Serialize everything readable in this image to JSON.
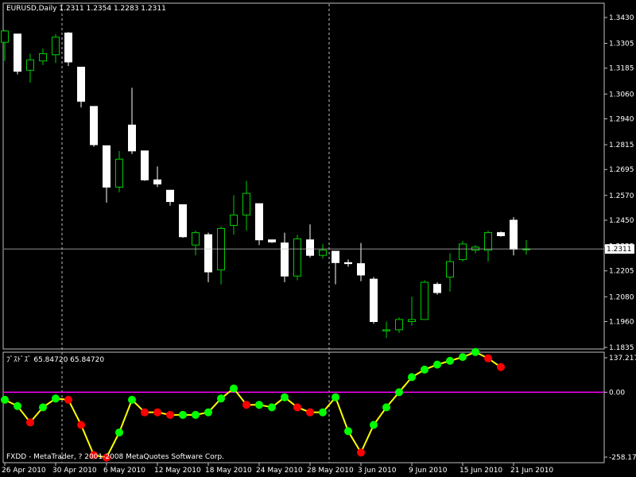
{
  "header": {
    "symbol_info": "EURUSD,Daily  1.2311 1.2354 1.2283 1.2311",
    "indicator_info": "ﾌﾞｽﾄﾞｽﾞ 65.84720 65.84720",
    "footer": "FXDD - MetaTrader, ? 2001-2008 MetaQuotes Software Corp."
  },
  "colors": {
    "background": "#000000",
    "bull_candle_fill": "#000000",
    "bull_candle_line": "#00cc00",
    "bear_candle_fill": "#ffffff",
    "bear_candle_line": "#ffffff",
    "indicator_line": "#ffff00",
    "up_dot": "#00ff00",
    "down_dot": "#ff0000",
    "zero_line": "#ff00ff",
    "grid": "#c0c0c0",
    "text": "#ffffff"
  },
  "chart_data": [
    {
      "type": "candlestick",
      "title": "EURUSD,Daily",
      "ylim": [
        1.1835,
        1.343
      ],
      "y_ticks": [
        "1.3430",
        "1.3305",
        "1.3185",
        "1.3060",
        "1.2940",
        "1.2815",
        "1.2695",
        "1.2570",
        "1.2450",
        "1.2325",
        "1.2205",
        "1.2080",
        "1.1960",
        "1.1835"
      ],
      "current_price_label": "1.2311",
      "current_price": 1.2311,
      "x_ticks": [
        "26 Apr 2010",
        "30 Apr 2010",
        "6 May 2010",
        "12 May 2010",
        "18 May 2010",
        "24 May 2010",
        "28 May 2010",
        "3 Jun 2010",
        "9 Jun 2010",
        "15 Jun 2010",
        "21 Jun 2010"
      ],
      "x_tick_index": [
        0,
        4,
        8,
        12,
        16,
        20,
        24,
        28,
        32,
        36,
        40
      ],
      "period_separator_index": [
        4.5,
        25.5
      ],
      "ohlc": [
        [
          1.331,
          1.337,
          1.322,
          1.3365
        ],
        [
          1.335,
          1.335,
          1.3155,
          1.317
        ],
        [
          1.3175,
          1.3255,
          1.3115,
          1.3225
        ],
        [
          1.322,
          1.328,
          1.32,
          1.3255
        ],
        [
          1.325,
          1.335,
          1.321,
          1.3335
        ],
        [
          1.3355,
          1.336,
          1.3195,
          1.3215
        ],
        [
          1.319,
          1.319,
          1.2995,
          1.3025
        ],
        [
          1.3,
          1.3,
          1.2805,
          1.2815
        ],
        [
          1.281,
          1.281,
          1.2535,
          1.261
        ],
        [
          1.261,
          1.2785,
          1.2585,
          1.2745
        ],
        [
          1.291,
          1.309,
          1.277,
          1.2785
        ],
        [
          1.2785,
          1.2785,
          1.264,
          1.2645
        ],
        [
          1.2645,
          1.271,
          1.261,
          1.2625
        ],
        [
          1.2595,
          1.2595,
          1.252,
          1.254
        ],
        [
          1.2525,
          1.2525,
          1.2365,
          1.237
        ],
        [
          1.233,
          1.24,
          1.228,
          1.239
        ],
        [
          1.238,
          1.239,
          1.215,
          1.22
        ],
        [
          1.221,
          1.242,
          1.214,
          1.241
        ],
        [
          1.2425,
          1.257,
          1.238,
          1.2475
        ],
        [
          1.2475,
          1.264,
          1.24,
          1.258
        ],
        [
          1.253,
          1.253,
          1.233,
          1.2355
        ],
        [
          1.2355,
          1.2355,
          1.234,
          1.2345
        ],
        [
          1.234,
          1.239,
          1.215,
          1.218
        ],
        [
          1.218,
          1.238,
          1.216,
          1.236
        ],
        [
          1.2355,
          1.243,
          1.227,
          1.228
        ],
        [
          1.228,
          1.2335,
          1.2265,
          1.2305
        ],
        [
          1.23,
          1.23,
          1.214,
          1.2245
        ],
        [
          1.2245,
          1.226,
          1.2225,
          1.224
        ],
        [
          1.224,
          1.234,
          1.2155,
          1.2185
        ],
        [
          1.2165,
          1.2175,
          1.195,
          1.196
        ],
        [
          1.1915,
          1.196,
          1.188,
          1.192
        ],
        [
          1.192,
          1.198,
          1.1905,
          1.197
        ],
        [
          1.196,
          1.208,
          1.194,
          1.197
        ],
        [
          1.197,
          1.216,
          1.197,
          1.215
        ],
        [
          1.214,
          1.215,
          1.209,
          1.21
        ],
        [
          1.2175,
          1.229,
          1.2105,
          1.225
        ],
        [
          1.226,
          1.235,
          1.225,
          1.2335
        ],
        [
          1.2305,
          1.233,
          1.229,
          1.232
        ],
        [
          1.2305,
          1.24,
          1.225,
          1.239
        ],
        [
          1.239,
          1.2395,
          1.237,
          1.2375
        ],
        [
          1.245,
          1.2465,
          1.228,
          1.231
        ],
        [
          1.2311,
          1.2354,
          1.2283,
          1.2311
        ]
      ]
    },
    {
      "type": "line",
      "title": "ﾌﾞｽﾄﾞｽﾞ",
      "ylim": [
        -258.171,
        137.2173
      ],
      "y_ticks": [
        "137.2173",
        "0.00",
        "-258.171"
      ],
      "zero_line": 0,
      "series": [
        {
          "values": [
            -30,
            -55,
            -120,
            -60,
            -25,
            -30,
            -130,
            -250,
            -260,
            -160,
            -30,
            -80,
            -80,
            -90,
            -90,
            -90,
            -80,
            -25,
            15,
            -50,
            -50,
            -60,
            -20,
            -60,
            -80,
            -80,
            -20,
            -155,
            -240,
            -130,
            -60,
            0,
            60,
            90,
            110,
            125,
            140,
            160,
            135,
            100
          ],
          "dot_colors": [
            "green",
            "green",
            "red",
            "green",
            "green",
            "red",
            "red",
            "red",
            "red",
            "green",
            "green",
            "red",
            "red",
            "red",
            "green",
            "green",
            "green",
            "green",
            "green",
            "red",
            "green",
            "green",
            "green",
            "red",
            "red",
            "green",
            "green",
            "green",
            "red",
            "green",
            "green",
            "green",
            "green",
            "green",
            "green",
            "green",
            "green",
            "green",
            "red",
            "red"
          ]
        }
      ]
    }
  ]
}
